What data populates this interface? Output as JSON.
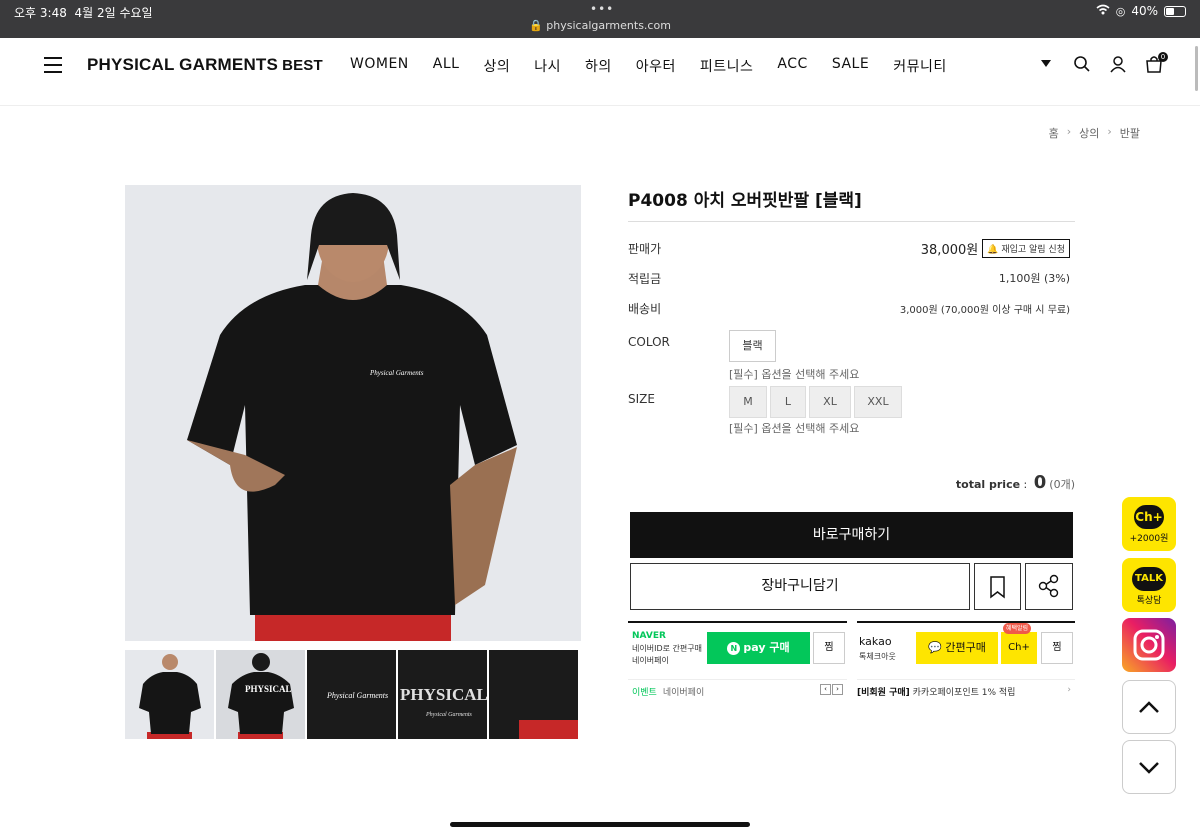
{
  "status": {
    "time": "오후 3:48",
    "date": "4월 2일 수요일",
    "url": "physicalgarments.com",
    "battery": "40%",
    "dots": "•••"
  },
  "header": {
    "logo": "PHYSICAL GARMENTS",
    "logo_suffix": "BEST",
    "nav": [
      "WOMEN",
      "ALL",
      "상의",
      "나시",
      "하의",
      "아우터",
      "피트니스",
      "ACC",
      "SALE",
      "커뮤니티"
    ],
    "cart_count": "0"
  },
  "breadcrumb": [
    "홈",
    "상의",
    "반팔"
  ],
  "product": {
    "title": "P4008 아치 오버핏반팔 [블랙]",
    "price_label": "판매가",
    "price": "38,000원",
    "restock_label": "재입고 알림 신청",
    "points_label": "적립금",
    "points": "1,100원 (3%)",
    "shipping_label": "배송비",
    "shipping": "3,000원 (70,000원 이상 구매 시 무료)",
    "color_label": "COLOR",
    "color_options": [
      "블랙"
    ],
    "color_hint": "[필수] 옵션을 선택해 주세요",
    "size_label": "SIZE",
    "size_options": [
      "M",
      "L",
      "XL",
      "XXL"
    ],
    "size_hint": "[필수] 옵션을 선택해 주세요",
    "total_label": "total price",
    "total_value": "0",
    "total_count": "(0개)",
    "buy_now": "바로구매하기",
    "add_cart": "장바구니담기"
  },
  "naver": {
    "logo": "NAVER",
    "sub1": "네이버ID로 간편구매",
    "sub2": "네이버페이",
    "pay_label": "pay 구매",
    "zzim": "찜",
    "event_tag": "이벤트",
    "event_text": "네이버페이"
  },
  "kakao": {
    "logo": "kakao",
    "sub": "톡체크아웃",
    "pay_label": "간편구매",
    "ch_badge": "혜택알림",
    "ch_label": "Ch+",
    "zzim": "찜",
    "notice_tag": "[비회원 구매]",
    "notice_text": "카카오페이포인트 1% 적립"
  },
  "floating": {
    "ch_label": "Ch+",
    "ch_sub": "+2000원",
    "talk_label": "TALK",
    "talk_sub": "톡상담"
  },
  "colors": {
    "naver_green": "#03c75a",
    "kakao_yellow": "#fee500",
    "buy_black": "#111111"
  }
}
